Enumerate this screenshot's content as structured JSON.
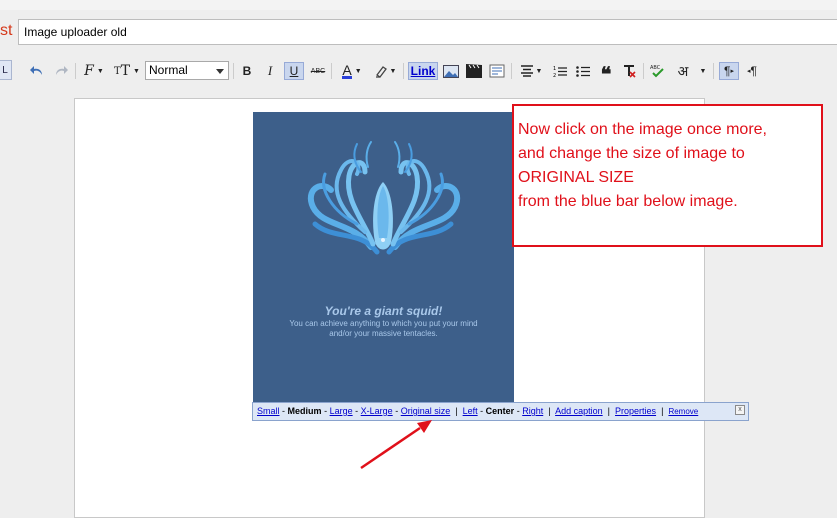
{
  "post": {
    "title_partial": "st",
    "title_value": "Image uploader old"
  },
  "toolbar": {
    "edge_label": "L",
    "format_select": {
      "selected": "Normal"
    },
    "bold_label": "B",
    "italic_label": "I",
    "underline_label": "U",
    "strike_label": "ABC",
    "font_color_label": "A",
    "link_label": "Link",
    "hindi_label": "अ",
    "icons": [
      "undo-icon",
      "redo-icon",
      "font-icon",
      "font-size-icon",
      "highlight-icon",
      "image-icon",
      "video-icon",
      "jump-break-icon",
      "align-icon",
      "numbered-list-icon",
      "bullet-list-icon",
      "quote-icon",
      "clear-format-icon",
      "spellcheck-icon",
      "transliterate-icon",
      "ltr-icon",
      "rtl-icon"
    ]
  },
  "image": {
    "title": "You're a giant squid!",
    "subtitle_line1": "You can achieve anything to which you put your mind",
    "subtitle_line2": "and/or your massive tentacles."
  },
  "image_bar": {
    "small": "Small",
    "medium": "Medium",
    "large": "Large",
    "xlarge": "X-Large",
    "original": "Original size",
    "left": "Left",
    "center": "Center",
    "right": "Right",
    "add_caption": "Add caption",
    "properties": "Properties",
    "remove": "Remove",
    "dash": "-",
    "pipe": "|",
    "close": "x"
  },
  "callout": {
    "line1": "Now click on the image once more,",
    "line2": "and change the size of image to",
    "line3": "ORIGINAL SIZE",
    "line4": " from the blue bar below image."
  },
  "colors": {
    "accent_red": "#e0101a",
    "image_bg": "#3d5f8a",
    "bar_bg": "#dde7f6"
  }
}
